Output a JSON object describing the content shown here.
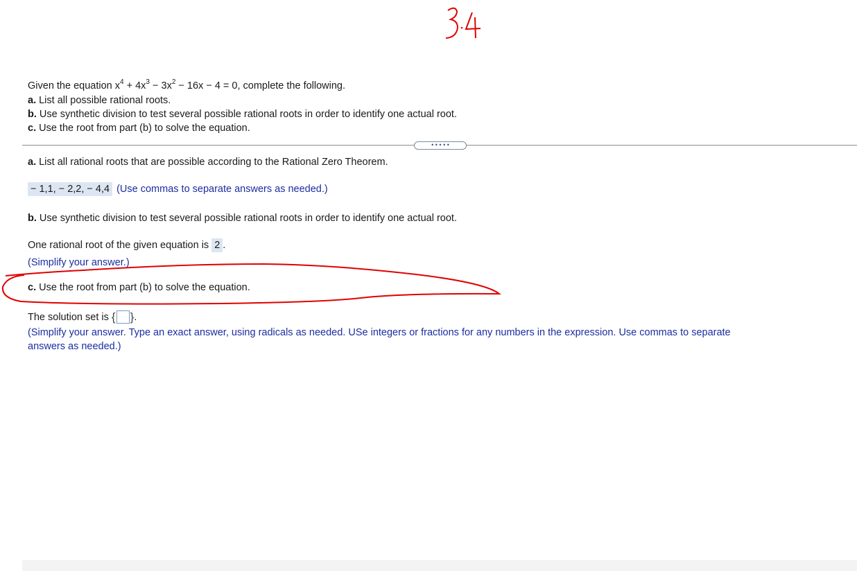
{
  "handwritten_note": "3.4",
  "problem": {
    "intro_prefix": "Given the equation x",
    "exp1": "4",
    "term2": " + 4x",
    "exp2": "3",
    "term3": " − 3x",
    "exp3": "2",
    "intro_suffix": " − 16x − 4 = 0, complete the following.",
    "a_label": "a.",
    "a_text": " List all possible rational roots.",
    "b_label": "b.",
    "b_text": " Use synthetic division to test several possible rational roots in order to identify one actual root.",
    "c_label": "c.",
    "c_text": " Use the root from part (b) to solve the equation."
  },
  "expand_button": "• • • • •",
  "part_a": {
    "label": "a.",
    "text": " List all rational roots that are possible according to the Rational Zero Theorem.",
    "answer": "− 1,1, − 2,2, − 4,4",
    "hint": "(Use commas to separate answers as needed.)"
  },
  "part_b": {
    "label": "b.",
    "text": " Use synthetic division to test several possible rational roots in order to identify one actual root.",
    "prompt": "One rational root of the given equation is",
    "answer": "2",
    "period": ".",
    "hint": "(Simplify your answer.)"
  },
  "part_c": {
    "label": "c.",
    "text": " Use the root from part (b) to solve the equation.",
    "prompt": "The solution set is",
    "open_brace": "{",
    "close_brace": "}",
    "period": ".",
    "hint_line1": "(Simplify your answer. Type an exact answer, using radicals as needed. USe integers or fractions for any numbers in the expression. Use commas to separate",
    "hint_line2": "answers as needed.)"
  },
  "colors": {
    "hint": "#1a2da0",
    "answer_bg": "#dce6f2",
    "annotation_red": "#e00000"
  }
}
